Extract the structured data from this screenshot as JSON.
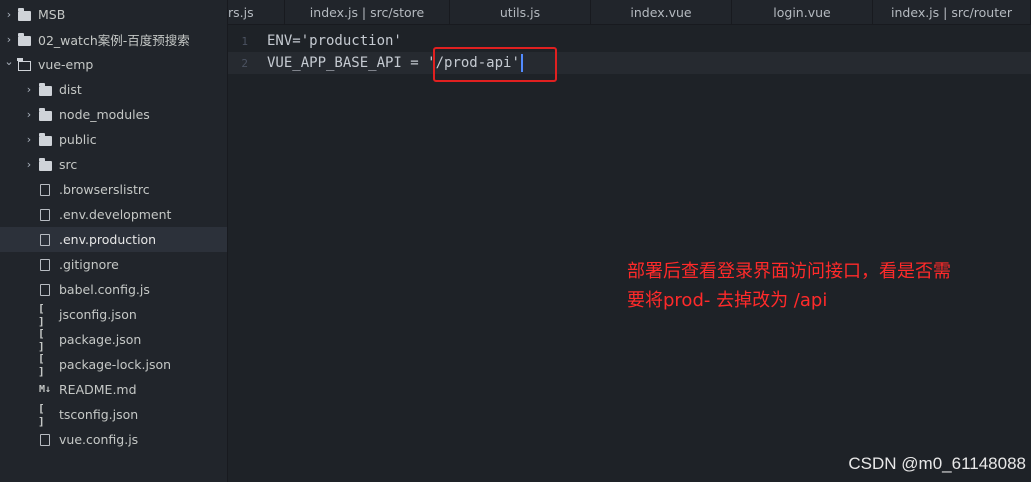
{
  "sidebar": {
    "items": [
      {
        "label": "MSB",
        "kind": "folder-closed",
        "expandable": true,
        "depth": 0,
        "icon": "folder-icon"
      },
      {
        "label": "02_watch案例-百度预搜索",
        "kind": "folder-closed",
        "expandable": true,
        "depth": 0,
        "icon": "folder-icon"
      },
      {
        "label": "vue-emp",
        "kind": "folder-open",
        "expandable": true,
        "expanded": true,
        "depth": 0,
        "icon": "folder-open-icon"
      },
      {
        "label": "dist",
        "kind": "folder",
        "expandable": true,
        "depth": 1,
        "icon": "folder-icon"
      },
      {
        "label": "node_modules",
        "kind": "folder",
        "expandable": true,
        "depth": 1,
        "icon": "folder-icon"
      },
      {
        "label": "public",
        "kind": "folder",
        "expandable": true,
        "depth": 1,
        "icon": "folder-icon"
      },
      {
        "label": "src",
        "kind": "folder",
        "expandable": true,
        "depth": 1,
        "icon": "folder-icon"
      },
      {
        "label": ".browserslistrc",
        "kind": "file",
        "depth": 1,
        "icon": "file-icon"
      },
      {
        "label": ".env.development",
        "kind": "file",
        "depth": 1,
        "icon": "file-icon"
      },
      {
        "label": ".env.production",
        "kind": "file",
        "depth": 1,
        "icon": "file-icon",
        "selected": true
      },
      {
        "label": ".gitignore",
        "kind": "file",
        "depth": 1,
        "icon": "file-icon"
      },
      {
        "label": "babel.config.js",
        "kind": "js",
        "depth": 1,
        "icon": "js-file-icon"
      },
      {
        "label": "jsconfig.json",
        "kind": "json",
        "depth": 1,
        "icon": "json-file-icon",
        "glyph": "[ ]"
      },
      {
        "label": "package.json",
        "kind": "json",
        "depth": 1,
        "icon": "json-file-icon",
        "glyph": "[ ]"
      },
      {
        "label": "package-lock.json",
        "kind": "json",
        "depth": 1,
        "icon": "json-file-icon",
        "glyph": "[ ]"
      },
      {
        "label": "README.md",
        "kind": "md",
        "depth": 1,
        "icon": "markdown-file-icon",
        "glyph": "M↓"
      },
      {
        "label": "tsconfig.json",
        "kind": "json",
        "depth": 1,
        "icon": "json-file-icon",
        "glyph": "[ ]"
      },
      {
        "label": "vue.config.js",
        "kind": "js",
        "depth": 1,
        "icon": "js-file-icon"
      }
    ]
  },
  "tabs": [
    {
      "label": "rs.js"
    },
    {
      "label": "index.js | src/store"
    },
    {
      "label": "utils.js"
    },
    {
      "label": "index.vue"
    },
    {
      "label": "login.vue"
    },
    {
      "label": "index.js | src/router"
    }
  ],
  "editor": {
    "lines": [
      {
        "number": "1",
        "text": "ENV='production'"
      },
      {
        "number": "2",
        "prefix": "VUE_APP_BASE_API = ",
        "value": "'/prod-api'",
        "active": true
      }
    ]
  },
  "annotation": {
    "line1": "部署后查看登录界面访问接口，看是否需",
    "line2": "要将prod- 去掉改为 /api",
    "color": "#ff2a2a"
  },
  "watermark": "CSDN @m0_61148088"
}
